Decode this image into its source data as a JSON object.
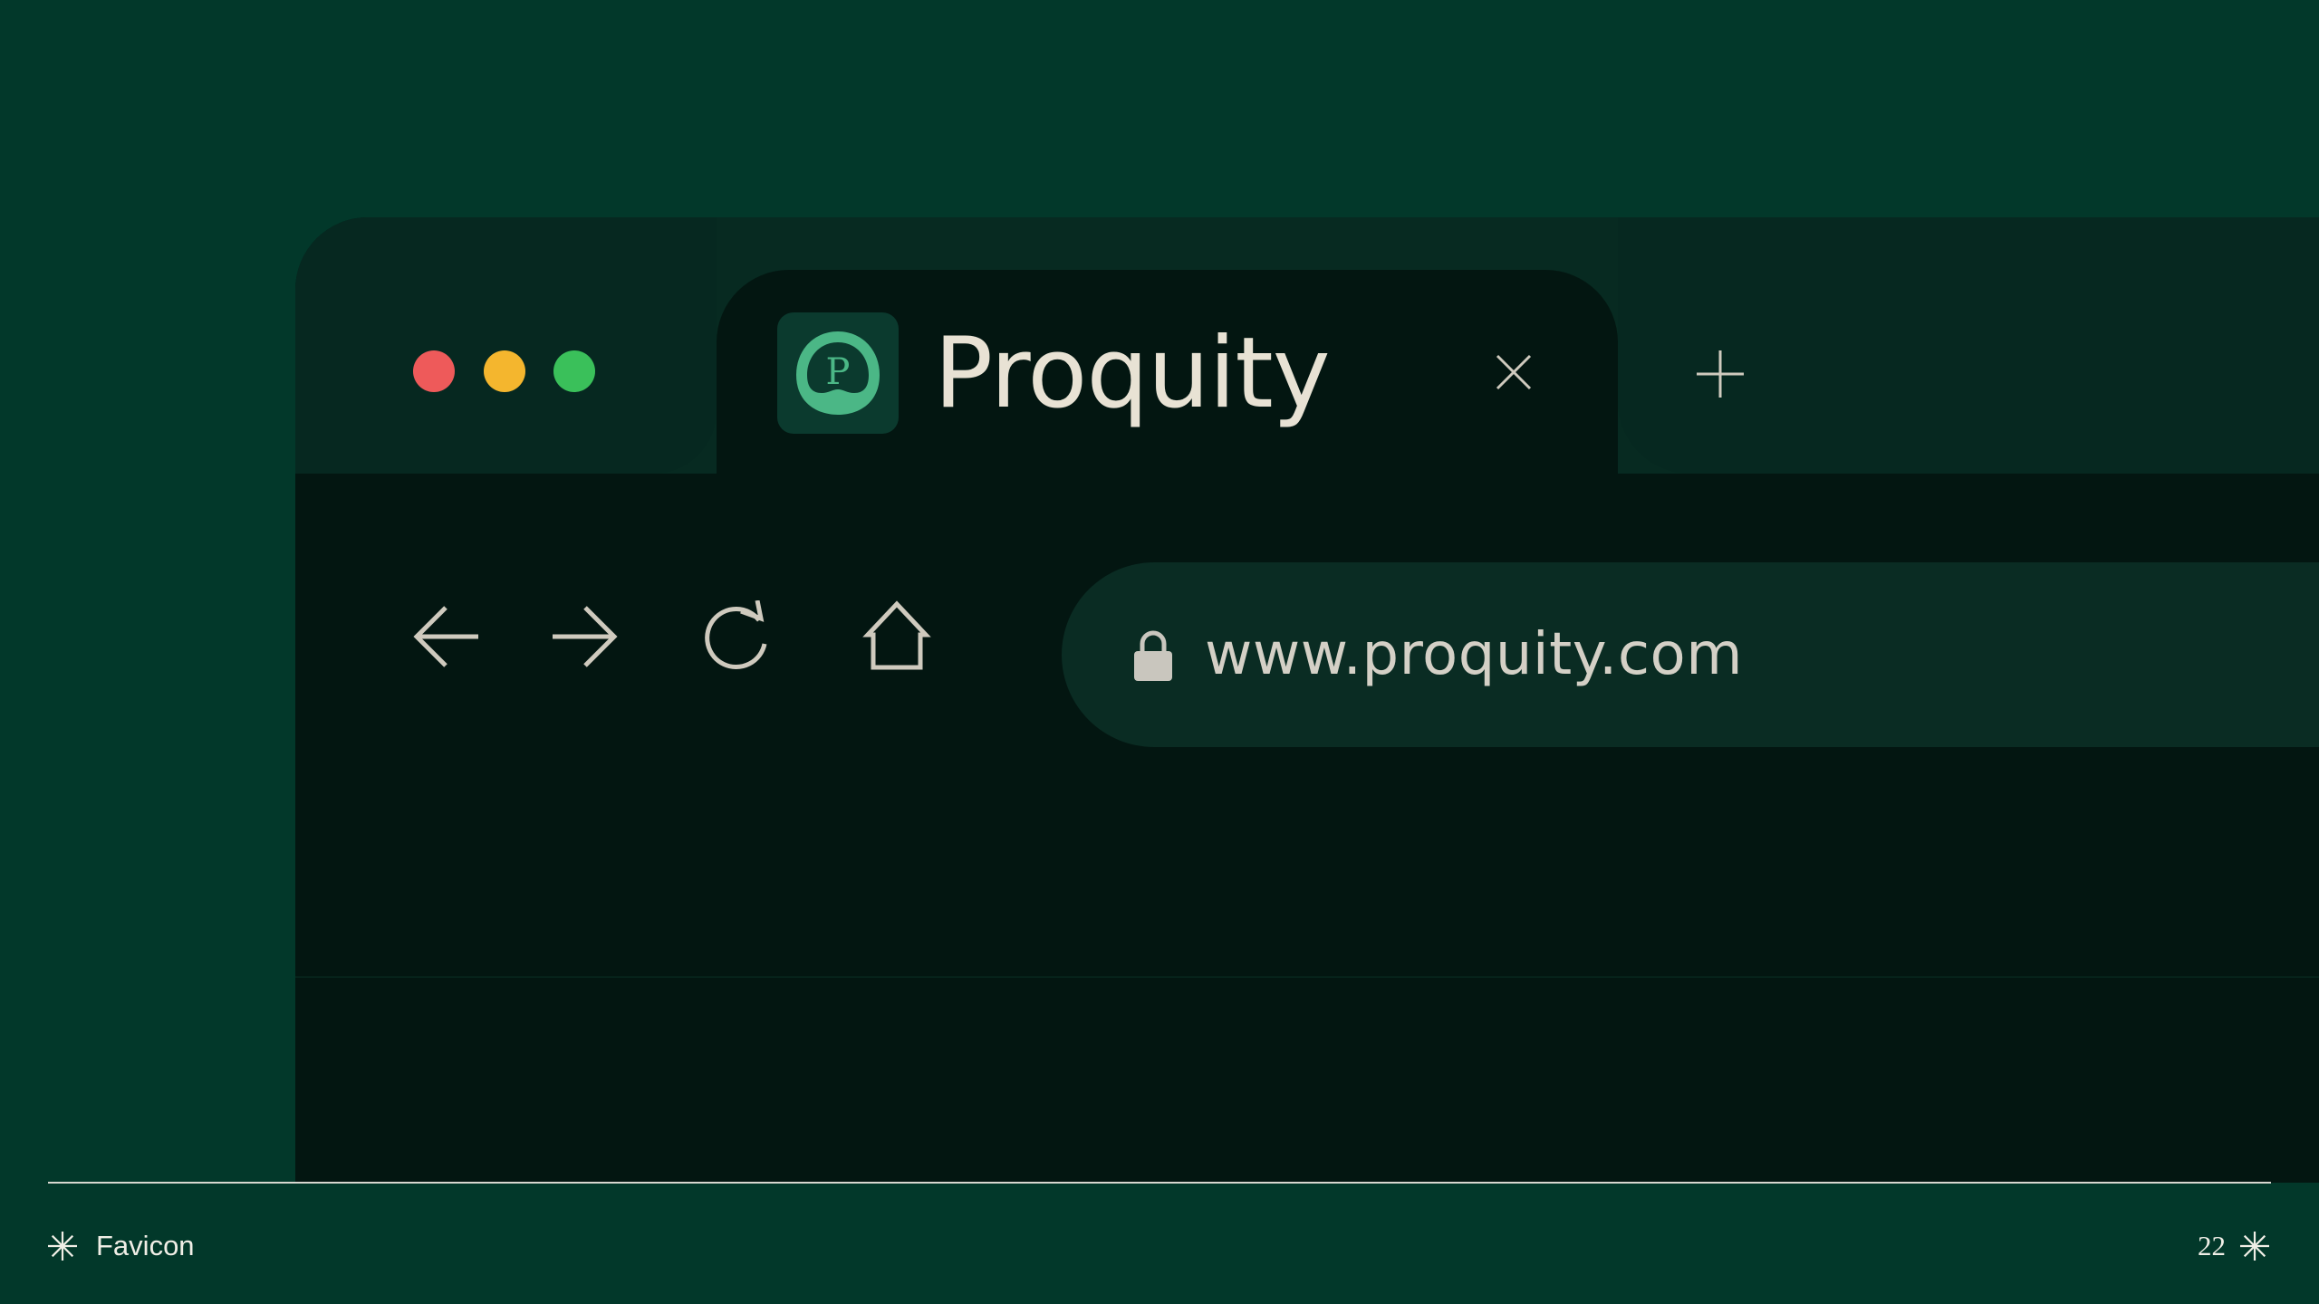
{
  "browser": {
    "window_controls": {
      "close_color": "#ee5a5a",
      "minimize_color": "#f4b62e",
      "maximize_color": "#3ac05a"
    },
    "tab": {
      "favicon": "proquity-p-logo",
      "favicon_letter": "P",
      "title": "Proquity",
      "close_icon": "close-icon"
    },
    "new_tab_icon": "plus-icon",
    "nav": {
      "back_icon": "arrow-left-icon",
      "forward_icon": "arrow-right-icon",
      "reload_icon": "reload-icon",
      "home_icon": "home-icon"
    },
    "address_bar": {
      "lock_icon": "lock-icon",
      "url": "www.proquity.com"
    }
  },
  "footer": {
    "label": "Favicon",
    "page_number": "22",
    "left_icon": "asterisk-icon",
    "right_icon": "asterisk-icon"
  },
  "colors": {
    "background": "#02382a",
    "browser_body": "#031611",
    "tab_strip": "#062820",
    "favicon_green": "#4bb786",
    "text_light": "#e8e2d4"
  }
}
